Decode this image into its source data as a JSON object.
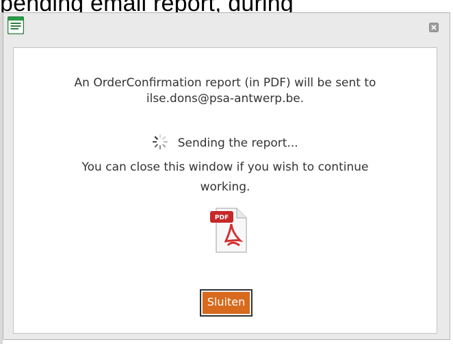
{
  "background": {
    "partial_text": "pending email report, during"
  },
  "dialog": {
    "app_icon": "report-window-icon",
    "close_icon": "close-icon",
    "message_line1": "An OrderConfirmation report (in PDF) will be sent to",
    "message_line2": "ilse.dons@psa-antwerp.be.",
    "status_text": "Sending the report...",
    "info_line1": "You can close this window if you wish to continue",
    "info_line2": "working.",
    "pdf_icon_label": "PDF",
    "close_button_label": "Sluiten",
    "accent_color": "#d76a1c"
  }
}
